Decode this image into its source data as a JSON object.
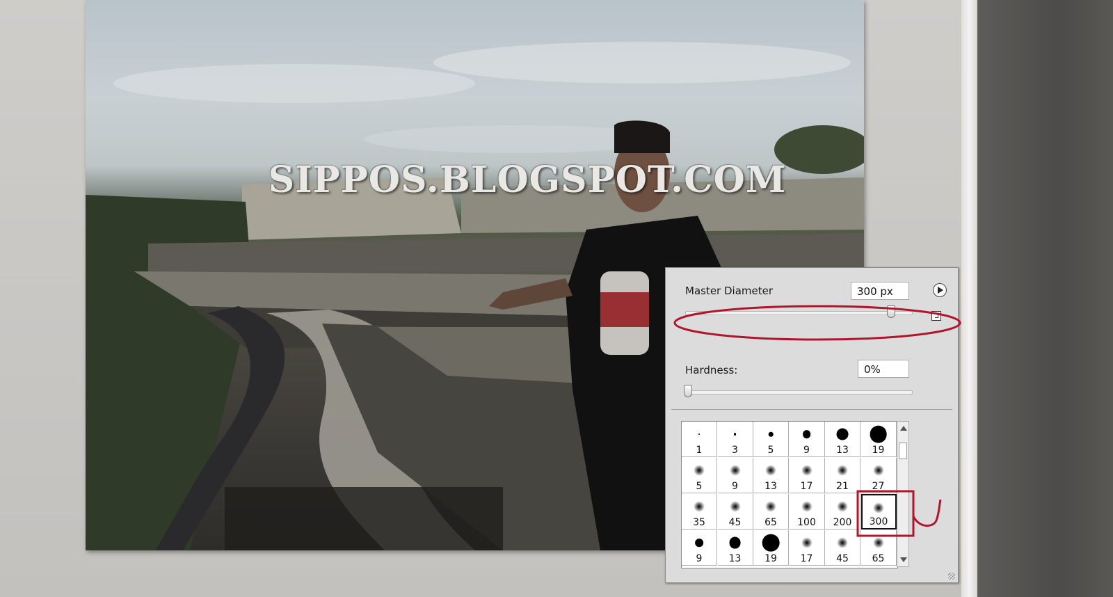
{
  "canvas": {
    "watermark": "SIPPOS.BLOGSPOT.COM"
  },
  "brush_picker": {
    "master_diameter_label": "Master Diameter",
    "master_diameter_value": "300 px",
    "master_diameter_level": 0.91,
    "hardness_label": "Hardness:",
    "hardness_value": "0%",
    "hardness_level": 0.0,
    "presets": [
      {
        "size": "1",
        "style": "hard"
      },
      {
        "size": "3",
        "style": "hard"
      },
      {
        "size": "5",
        "style": "hard"
      },
      {
        "size": "9",
        "style": "hard"
      },
      {
        "size": "13",
        "style": "hard"
      },
      {
        "size": "19",
        "style": "hard"
      },
      {
        "size": "5",
        "style": "soft"
      },
      {
        "size": "9",
        "style": "soft"
      },
      {
        "size": "13",
        "style": "soft"
      },
      {
        "size": "17",
        "style": "soft"
      },
      {
        "size": "21",
        "style": "soft"
      },
      {
        "size": "27",
        "style": "soft"
      },
      {
        "size": "35",
        "style": "soft"
      },
      {
        "size": "45",
        "style": "soft"
      },
      {
        "size": "65",
        "style": "soft"
      },
      {
        "size": "100",
        "style": "soft"
      },
      {
        "size": "200",
        "style": "soft"
      },
      {
        "size": "300",
        "style": "soft",
        "selected": true
      },
      {
        "size": "9",
        "style": "hard"
      },
      {
        "size": "13",
        "style": "hard"
      },
      {
        "size": "19",
        "style": "hard"
      },
      {
        "size": "17",
        "style": "soft"
      },
      {
        "size": "45",
        "style": "soft"
      },
      {
        "size": "65",
        "style": "soft"
      }
    ]
  },
  "colors": {
    "annotation": "#b0162b",
    "popup_bg": "#dcdcdc",
    "workspace_bg": "#c8c6c3"
  },
  "icons": {
    "popup_menu": "flyout-menu-icon",
    "new_preset": "new-preset-icon",
    "scroll_up": "scroll-up-arrow-icon",
    "scroll_down": "scroll-down-arrow-icon"
  }
}
